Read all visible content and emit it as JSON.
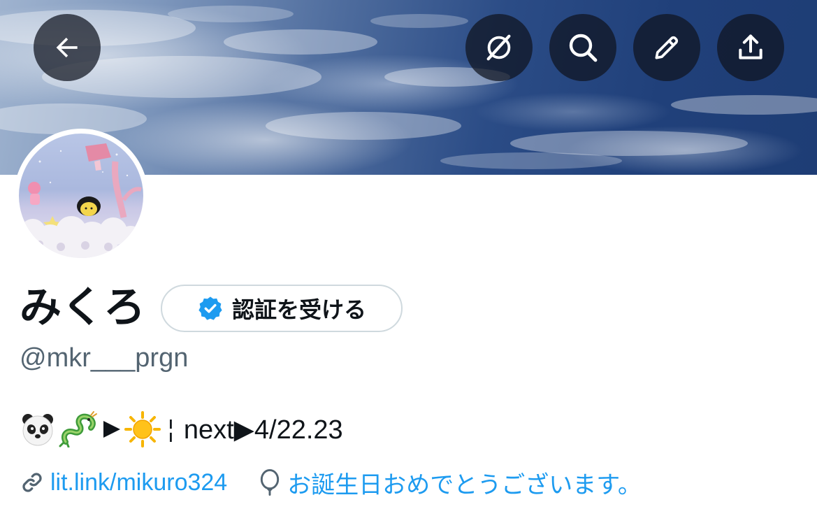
{
  "profile": {
    "display_name": "みくろ",
    "handle": "@mkr___prgn",
    "verify_label": "認証を受ける",
    "bio": {
      "emoji_1": "panda-emoji",
      "emoji_2": "dragon-emoji",
      "emoji_3": "sun-emoji",
      "separator": "¦",
      "text": "next▶︎4/22.23"
    },
    "link": "lit.link/mikuro324",
    "birthday": "お誕生日おめでとうございます。"
  },
  "toolbar": {
    "back_icon": "back-arrow-icon",
    "grok_icon": "circle-slash-icon",
    "search_icon": "search-icon",
    "edit_icon": "pencil-icon",
    "share_icon": "share-icon"
  },
  "colors": {
    "accent": "#1d9bf0",
    "text": "#0f1419",
    "secondary": "#536471",
    "pill_border": "#cfd9de"
  }
}
